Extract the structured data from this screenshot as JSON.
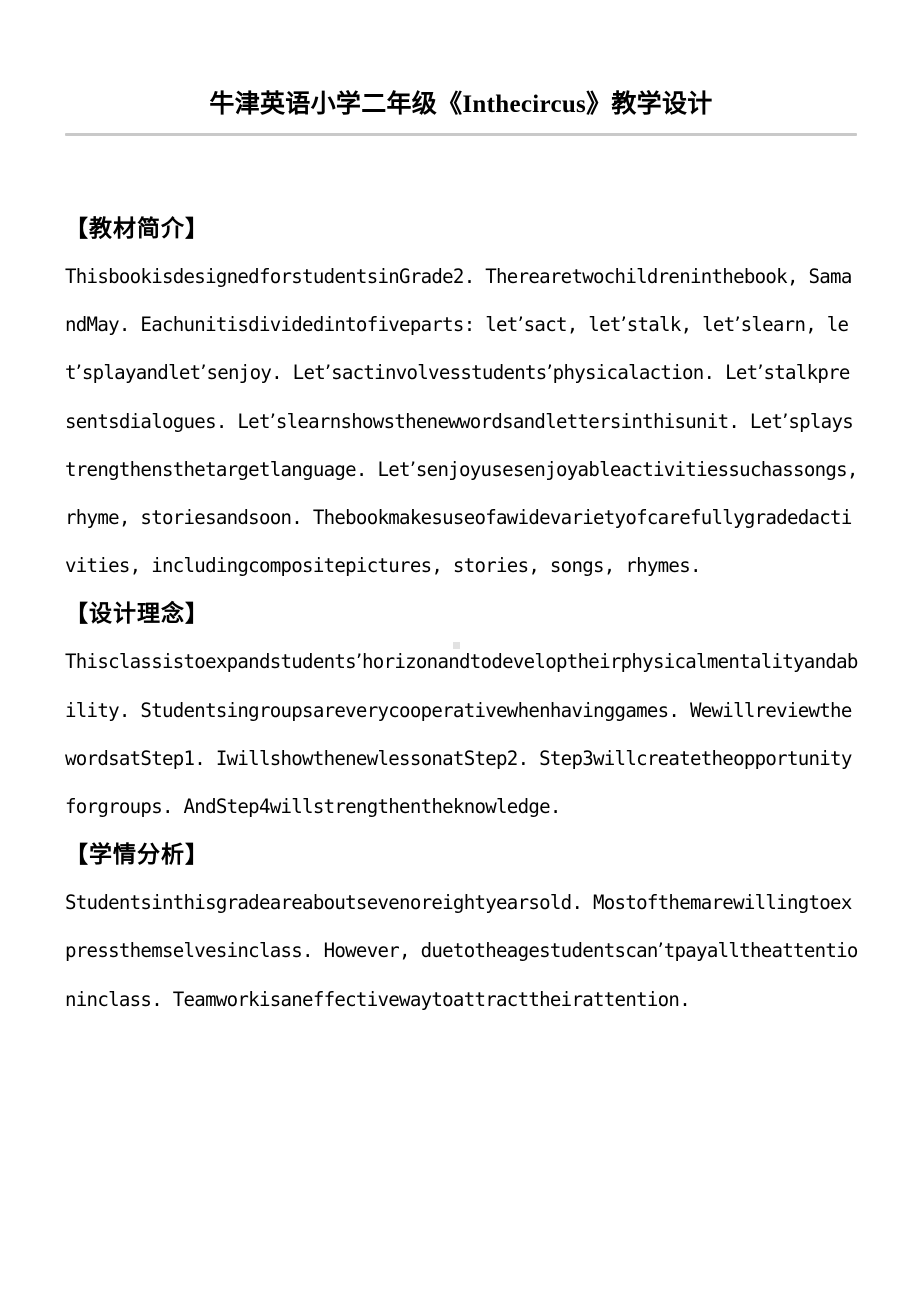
{
  "document": {
    "title": "牛津英语小学二年级《Inthecircus》教学设计",
    "rule_color": "#c9c9c9",
    "text_color": "#000000",
    "background_color": "#ffffff",
    "sections": [
      {
        "heading": "【教材简介】",
        "body": "ThisbookisdesignedforstudentsinGrade2. Therearetwochildreninthebook, SamandMay. Eachunitisdividedintofiveparts: let’sact, let’stalk, let’slearn, let’splayandlet’senjoy. Let’sactinvolvesstudents’physicalaction. Let’stalkpresentsdialogues. Let’slearnshowsthenewwordsandlettersinthisunit. Let’splaystrengthensthetargetlanguage. Let’senjoyusesenjoyableactivitiessuchassongs, rhyme, storiesandsoon. Thebookmakesuseofawidevarietyofcarefullygradedactivities, includingcompositepictures, stories, songs, rhymes."
      },
      {
        "heading": "【设计理念】",
        "body": "Thisclassistoexpandstudents’horizonandtodeveloptheirphysicalmentalityandability. Studentsingroupsareverycooperativewhenhavinggames. WewillreviewthewordsatStep1. IwillshowthenewlessonatStep2. Step3willcreatetheopportunityforgroups. AndStep4willstrengthentheknowledge."
      },
      {
        "heading": "【学情分析】",
        "body": "Studentsinthisgradeareaboutsevenoreightyearsold. Mostofthemarewillingtoexpressthemselvesinclass. However, duetotheagestudentscan’tpayalltheattentioninclass. Teamworkisaneffectivewaytoattracttheirattention."
      }
    ]
  }
}
